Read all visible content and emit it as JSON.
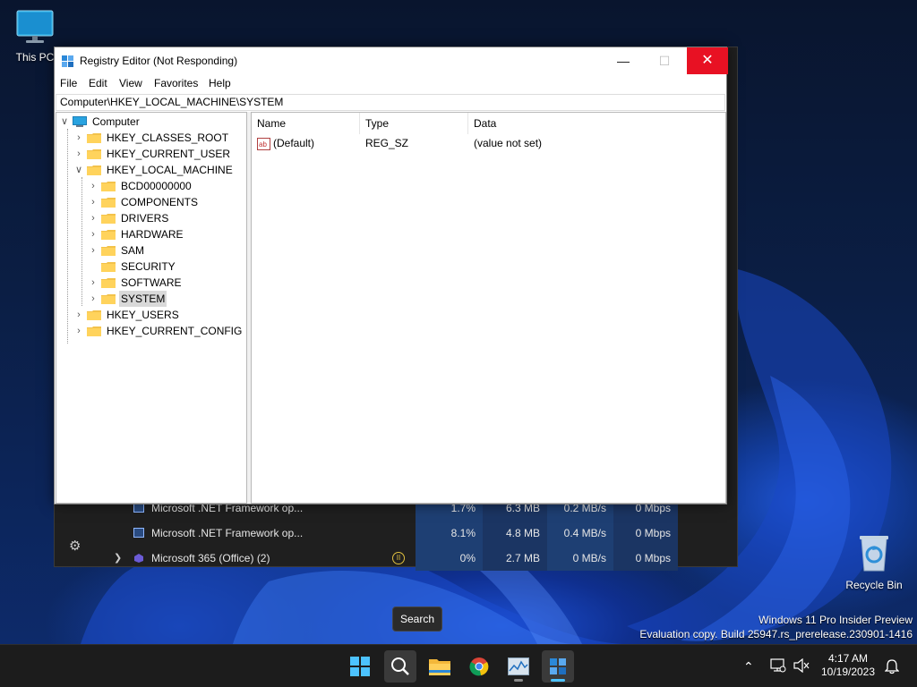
{
  "desktop": {
    "this_pc_label": "This PC",
    "recycle_bin_label": "Recycle Bin"
  },
  "task_manager": {
    "rows": [
      {
        "name": "Microsoft .NET Framework op...",
        "cpu": "1.7%",
        "memory": "6.3 MB",
        "disk": "0.2 MB/s",
        "network": "0 Mbps"
      },
      {
        "name": "Microsoft .NET Framework op...",
        "cpu": "8.1%",
        "memory": "4.8 MB",
        "disk": "0.4 MB/s",
        "network": "0 Mbps"
      },
      {
        "name": "Microsoft 365 (Office) (2)",
        "cpu": "0%",
        "memory": "2.7 MB",
        "disk": "0 MB/s",
        "network": "0 Mbps"
      }
    ]
  },
  "regedit": {
    "title": "Registry Editor (Not Responding)",
    "menu": [
      "File",
      "Edit",
      "View",
      "Favorites",
      "Help"
    ],
    "address": "Computer\\HKEY_LOCAL_MACHINE\\SYSTEM",
    "tree": {
      "root": "Computer",
      "hives": [
        "HKEY_CLASSES_ROOT",
        "HKEY_CURRENT_USER",
        "HKEY_LOCAL_MACHINE",
        "HKEY_USERS",
        "HKEY_CURRENT_CONFIG"
      ],
      "hklm_children": [
        "BCD00000000",
        "COMPONENTS",
        "DRIVERS",
        "HARDWARE",
        "SAM",
        "SECURITY",
        "SOFTWARE",
        "SYSTEM"
      ],
      "selected": "SYSTEM"
    },
    "columns": {
      "name": "Name",
      "type": "Type",
      "data": "Data"
    },
    "values": [
      {
        "name": "(Default)",
        "type": "REG_SZ",
        "data": "(value not set)"
      }
    ]
  },
  "tooltip": "Search",
  "watermark": {
    "line1": "Windows 11 Pro Insider Preview",
    "line2": "Evaluation copy. Build 25947.rs_prerelease.230901-1416"
  },
  "clock": {
    "time": "4:17 AM",
    "date": "10/19/2023"
  },
  "colors": {
    "accent": "#4cc2ff",
    "close_red": "#e81123",
    "selection": "#d9d9d9"
  }
}
